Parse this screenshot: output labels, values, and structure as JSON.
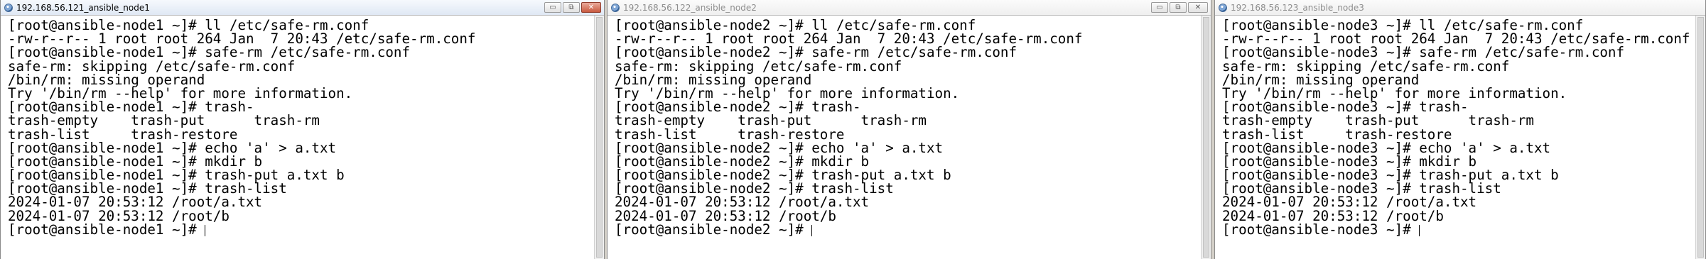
{
  "windows": [
    {
      "title": "192.168.56.121_ansible_node1",
      "lines": [
        "[root@ansible-node1 ~]# ll /etc/safe-rm.conf",
        "-rw-r--r-- 1 root root 264 Jan  7 20:43 /etc/safe-rm.conf",
        "[root@ansible-node1 ~]# safe-rm /etc/safe-rm.conf",
        "safe-rm: skipping /etc/safe-rm.conf",
        "/bin/rm: missing operand",
        "Try '/bin/rm --help' for more information.",
        "[root@ansible-node1 ~]# trash-",
        "trash-empty    trash-put      trash-rm",
        "trash-list     trash-restore",
        "[root@ansible-node1 ~]# echo 'a' > a.txt",
        "[root@ansible-node1 ~]# mkdir b",
        "[root@ansible-node1 ~]# trash-put a.txt b",
        "[root@ansible-node1 ~]# trash-list",
        "2024-01-07 20:53:12 /root/a.txt",
        "2024-01-07 20:53:12 /root/b",
        "[root@ansible-node1 ~]# "
      ]
    },
    {
      "title": "192.168.56.122_ansible_node2",
      "lines": [
        "[root@ansible-node2 ~]# ll /etc/safe-rm.conf",
        "-rw-r--r-- 1 root root 264 Jan  7 20:43 /etc/safe-rm.conf",
        "[root@ansible-node2 ~]# safe-rm /etc/safe-rm.conf",
        "safe-rm: skipping /etc/safe-rm.conf",
        "/bin/rm: missing operand",
        "Try '/bin/rm --help' for more information.",
        "[root@ansible-node2 ~]# trash-",
        "trash-empty    trash-put      trash-rm",
        "trash-list     trash-restore",
        "[root@ansible-node2 ~]# echo 'a' > a.txt",
        "[root@ansible-node2 ~]# mkdir b",
        "[root@ansible-node2 ~]# trash-put a.txt b",
        "[root@ansible-node2 ~]# trash-list",
        "2024-01-07 20:53:12 /root/a.txt",
        "2024-01-07 20:53:12 /root/b",
        "[root@ansible-node2 ~]# "
      ]
    },
    {
      "title": "192.168.56.123_ansible_node3",
      "lines": [
        "[root@ansible-node3 ~]# ll /etc/safe-rm.conf",
        "-rw-r--r-- 1 root root 264 Jan  7 20:43 /etc/safe-rm.conf",
        "[root@ansible-node3 ~]# safe-rm /etc/safe-rm.conf",
        "safe-rm: skipping /etc/safe-rm.conf",
        "/bin/rm: missing operand",
        "Try '/bin/rm --help' for more information.",
        "[root@ansible-node3 ~]# trash-",
        "trash-empty    trash-put      trash-rm",
        "trash-list     trash-restore",
        "[root@ansible-node3 ~]# echo 'a' > a.txt",
        "[root@ansible-node3 ~]# mkdir b",
        "[root@ansible-node3 ~]# trash-put a.txt b",
        "[root@ansible-node3 ~]# trash-list",
        "2024-01-07 20:53:12 /root/a.txt",
        "2024-01-07 20:53:12 /root/b",
        "[root@ansible-node3 ~]# "
      ]
    }
  ],
  "window_controls": {
    "minimize_glyph": "▭",
    "maximize_glyph": "⧉",
    "close_glyph": "✕"
  },
  "icons": {
    "app": "terminal-session-icon"
  },
  "colors": {
    "terminal_bg": "#ffffff",
    "terminal_fg": "#000000",
    "close_active": "#c95a40"
  }
}
